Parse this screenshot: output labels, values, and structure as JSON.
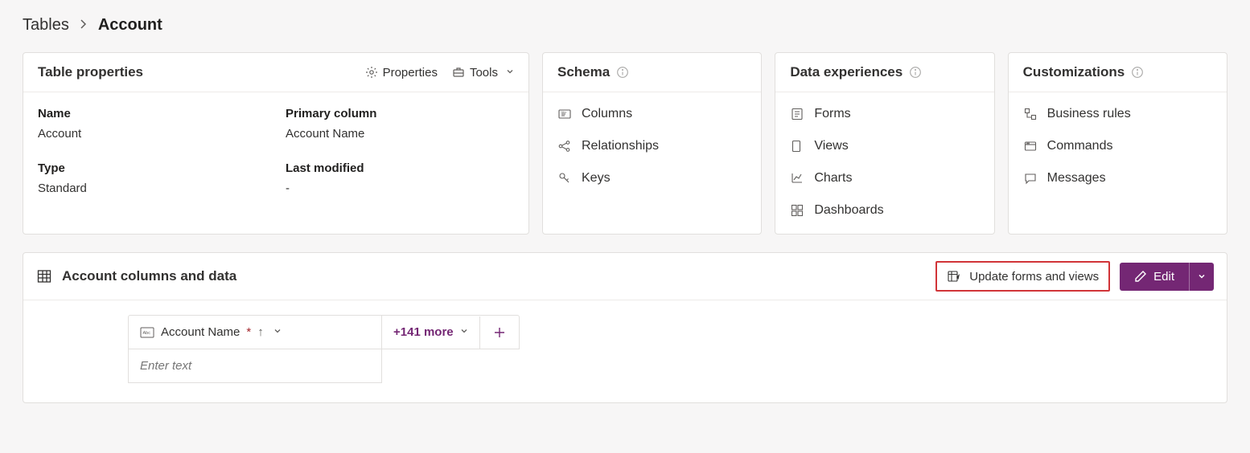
{
  "breadcrumb": {
    "parent": "Tables",
    "current": "Account"
  },
  "tableProps": {
    "header": "Table properties",
    "actions": {
      "properties": "Properties",
      "tools": "Tools"
    },
    "labels": {
      "name": "Name",
      "primaryColumn": "Primary column",
      "type": "Type",
      "lastModified": "Last modified"
    },
    "values": {
      "name": "Account",
      "primaryColumn": "Account Name",
      "type": "Standard",
      "lastModified": "-"
    }
  },
  "schema": {
    "header": "Schema",
    "items": {
      "columns": "Columns",
      "relationships": "Relationships",
      "keys": "Keys"
    }
  },
  "dataExp": {
    "header": "Data experiences",
    "items": {
      "forms": "Forms",
      "views": "Views",
      "charts": "Charts",
      "dashboards": "Dashboards"
    }
  },
  "custom": {
    "header": "Customizations",
    "items": {
      "businessRules": "Business rules",
      "commands": "Commands",
      "messages": "Messages"
    }
  },
  "dataPanel": {
    "title": "Account columns and data",
    "updateBtn": "Update forms and views",
    "editBtn": "Edit",
    "columnHeader": "Account Name",
    "moreLabel": "+141 more",
    "placeholder": "Enter text"
  }
}
